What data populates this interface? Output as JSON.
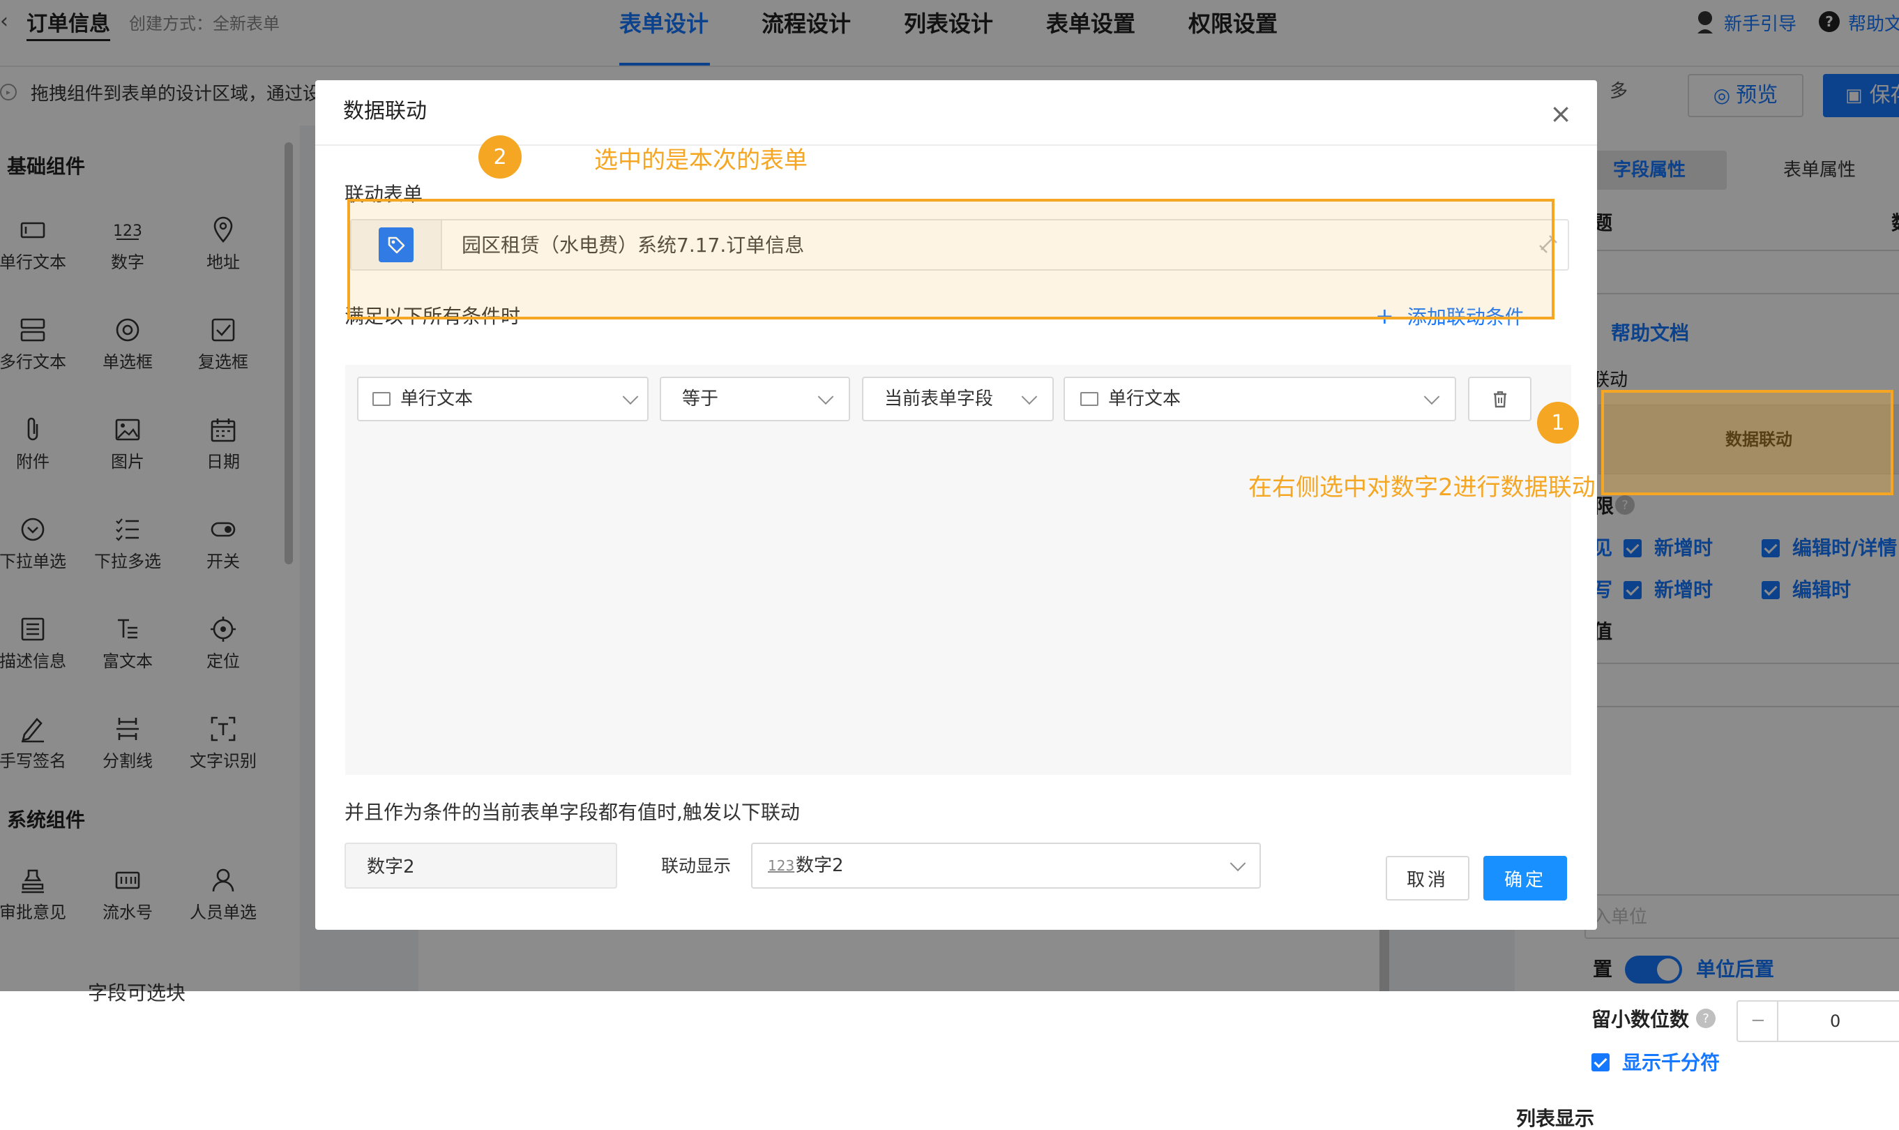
{
  "header": {
    "title": "订单信息",
    "create_mode": "创建方式：全新表单",
    "tabs": [
      "表单设计",
      "流程设计",
      "列表设计",
      "表单设置",
      "权限设置"
    ],
    "guide": "新手引导",
    "help": "帮助文"
  },
  "infobar": {
    "hint": "拖拽组件到表单的设计区域，通过设",
    "more": "多",
    "preview": "预览",
    "save": "保存"
  },
  "left_panel": {
    "basic_title": "基础组件",
    "basic_items": [
      "单行文本",
      "数字",
      "地址",
      "多行文本",
      "单选框",
      "复选框",
      "附件",
      "图片",
      "日期",
      "下拉单选",
      "下拉多选",
      "开关",
      "描述信息",
      "富文本",
      "定位",
      "手写签名",
      "分割线",
      "文字识别"
    ],
    "system_title": "系统组件",
    "system_items": [
      "审批意见",
      "流水号",
      "人员单选"
    ],
    "bottom_text": "字段可选块"
  },
  "right_panel": {
    "tab_field": "字段属性",
    "tab_form": "表单属性",
    "title_label": "题",
    "title_label_right": "数",
    "help_doc": "帮助文档",
    "linkage_label": "联动",
    "data_linkage": "数据联动",
    "perm_label": "限",
    "row1": {
      "prefix": "见",
      "a": "新增时",
      "b": "编辑时/详情"
    },
    "row2": {
      "prefix": "写",
      "a": "新增时",
      "b": "编辑时"
    },
    "row3": {
      "prefix": "值"
    },
    "unit_placeholder": "入单位",
    "unit_pos_label": "置",
    "unit_pos_value": "单位后置",
    "decimals_label": "留小数位数",
    "decimals_value": "0",
    "thousands": "显示千分符",
    "list_display": "列表显示"
  },
  "modal": {
    "title": "数据联动",
    "linked_form_label": "联动表单",
    "linked_form_value": "园区租赁（水电费）系统7.17.订单信息",
    "cond_label": "满足以下所有条件时",
    "add_condition": "添加联动条件",
    "condition": {
      "field": "单行文本",
      "operator": "等于",
      "source": "当前表单字段",
      "target": "单行文本"
    },
    "trigger_text": "并且作为条件的当前表单字段都有值时,触发以下联动",
    "result": {
      "field": "数字2",
      "action_label": "联动显示",
      "target_icon": "123",
      "target": "数字2"
    },
    "cancel": "取消",
    "ok": "确定"
  },
  "annotations": {
    "badge1": "1",
    "badge2": "2",
    "note1": "选中的是本次的表单",
    "note2": "在右侧选中对数字2进行数据联动",
    "color": "#f5a623"
  },
  "colors": {
    "primary": "#1677ff",
    "annotation": "#f5a623",
    "mask": "rgba(0,0,0,0.45)"
  }
}
